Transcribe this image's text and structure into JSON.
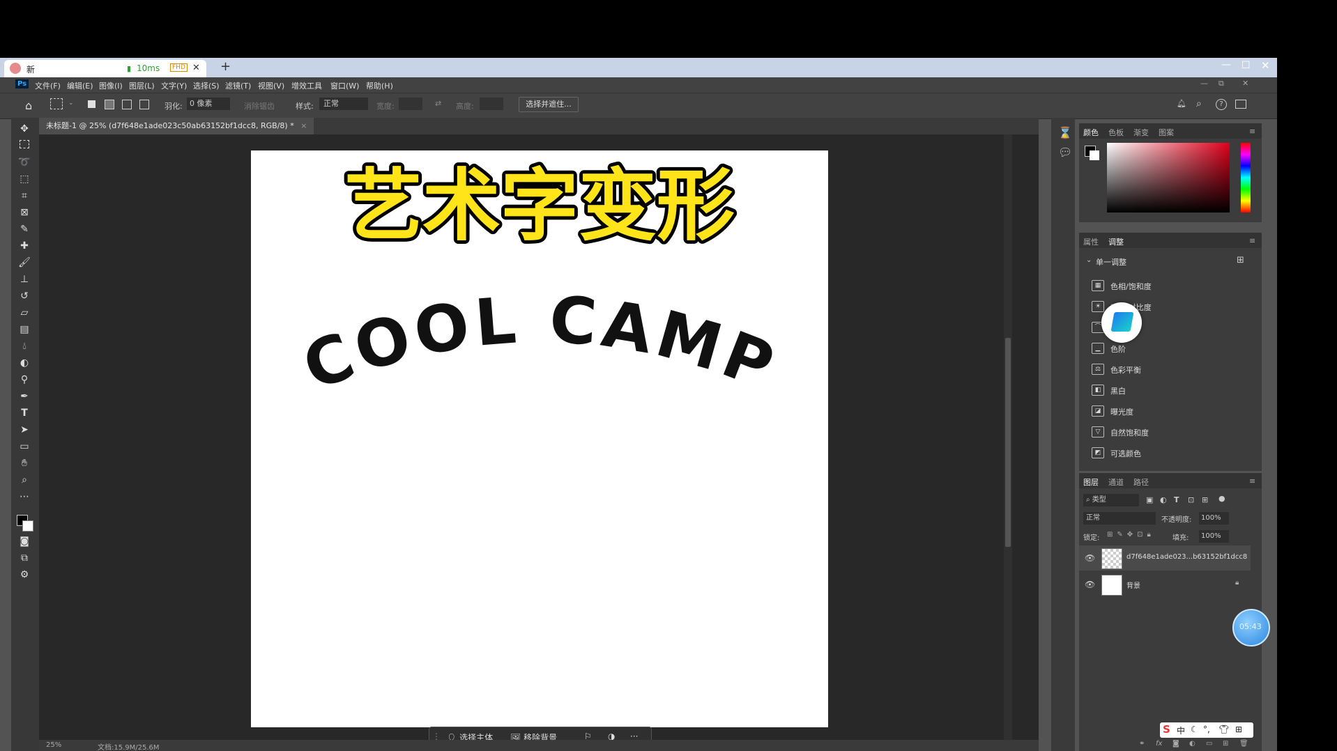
{
  "browser": {
    "tab_title": "新",
    "latency": "10ms",
    "fhd_badge": "FHD",
    "close_glyph": "✕",
    "new_tab_glyph": "+"
  },
  "app": {
    "logo": "Ps",
    "menu": [
      "文件(F)",
      "编辑(E)",
      "图像(I)",
      "图层(L)",
      "文字(Y)",
      "选择(S)",
      "滤镜(T)",
      "视图(V)",
      "增效工具",
      "窗口(W)",
      "帮助(H)"
    ]
  },
  "options": {
    "feather_label": "羽化:",
    "feather_value": "0 像素",
    "antialias_label": "消除锯齿",
    "style_label": "样式:",
    "style_value": "正常",
    "width_label": "宽度:",
    "height_label": "高度:",
    "select_mask_button": "选择并遮住..."
  },
  "document": {
    "tab_title": "未标题-1 @ 25% (d7f648e1ade023c50ab63152bf1dcc8, RGB/8) *",
    "heading_text": "艺术字变形",
    "arc_text": "COOL CAMP",
    "zoom": "25%",
    "doc_size": "文档:15.9M/25.6M"
  },
  "contextual_bar": {
    "select_subject": "选择主体",
    "remove_background": "移除背景",
    "more": "···"
  },
  "color_panel": {
    "tabs": [
      "颜色",
      "色板",
      "渐变",
      "图案"
    ]
  },
  "adjustments_panel": {
    "tabs": [
      "属性",
      "调整"
    ],
    "section_title": "单一调整",
    "items": [
      "色相/饱和度",
      "亮度/对比度",
      "曲线",
      "色阶",
      "色彩平衡",
      "黑白",
      "曝光度",
      "自然饱和度",
      "可选颜色"
    ]
  },
  "layers_panel": {
    "tabs": [
      "图层",
      "通道",
      "路径"
    ],
    "kind_filter": "类型",
    "blend_mode": "正常",
    "opacity_label": "不透明度:",
    "opacity_value": "100%",
    "lock_label": "锁定:",
    "fill_label": "填充:",
    "fill_value": "100%",
    "layers": [
      {
        "name": "d7f648e1ade023...b63152bf1dcc8"
      },
      {
        "name": "背景"
      }
    ]
  },
  "overlay": {
    "timer": "05:43",
    "ime_items": [
      "中",
      "♪"
    ]
  },
  "colors": {
    "heading_fill": "#ffe41a",
    "heading_stroke": "#000000",
    "ui_dark": "#424242",
    "canvas_bg": "#282828"
  }
}
